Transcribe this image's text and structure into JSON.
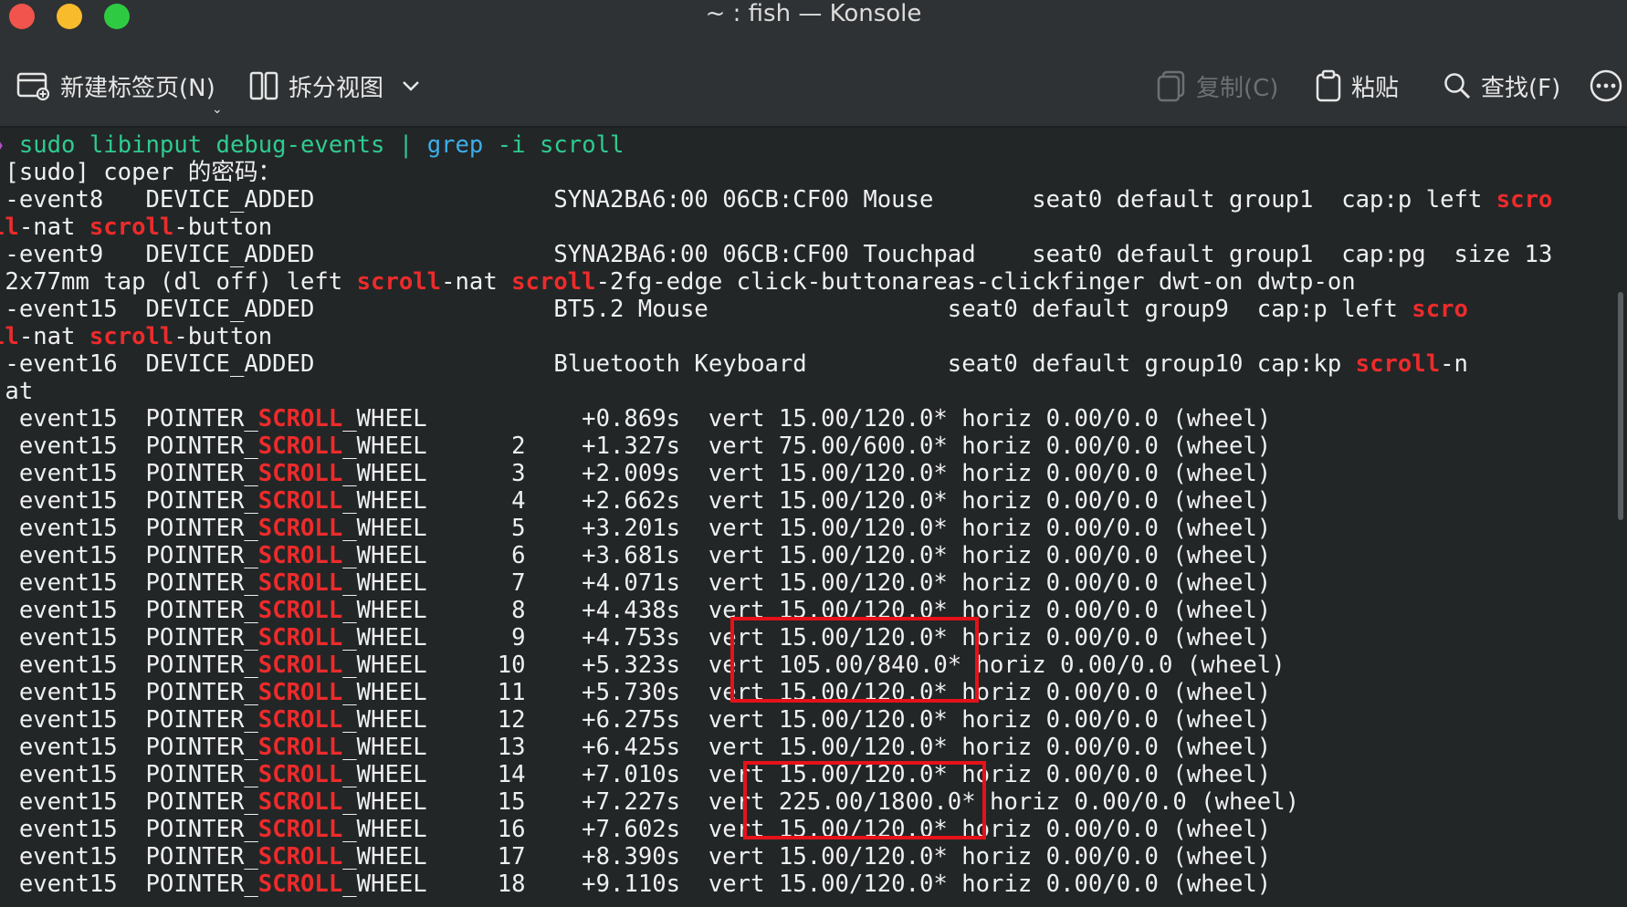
{
  "window": {
    "title": "~ : fish — Konsole"
  },
  "toolbar": {
    "new_tab_label": "新建标签页(N)",
    "split_view_label": "拆分视图",
    "copy_label": "复制(C)",
    "paste_label": "粘贴",
    "find_label": "查找(F)"
  },
  "icons": {
    "new_tab": "new-tab-icon",
    "split_view": "split-view-icon",
    "dropdown": "chevron-down-icon",
    "copy": "copy-icon",
    "paste": "clipboard-icon",
    "find": "search-icon",
    "more": "more-menu-icon"
  },
  "colors": {
    "background": "#232627",
    "titlebar": "#2f3234",
    "text": "#eff0f1",
    "command": "#2ecb8f",
    "grep": "#3daee9",
    "highlight": "#ed2b2b",
    "annotation_box": "#e5121a"
  },
  "terminal": {
    "lines": [
      [
        {
          "t": "❯ ",
          "c": "prompt-mark"
        },
        {
          "t": "sudo libinput debug-events ",
          "c": "cmd"
        },
        {
          "t": "| ",
          "c": "pipe"
        },
        {
          "t": "grep",
          "c": "grep"
        },
        {
          "t": " -i scroll",
          "c": "arg"
        }
      ],
      [
        {
          "t": " [sudo] coper 的密码："
        }
      ],
      [
        {
          "t": " -event8   DEVICE_ADDED                 SYNA2BA6:00 06CB:CF00 Mouse       seat0 default group1  cap:p left "
        },
        {
          "t": "scro",
          "c": "hl"
        }
      ],
      [
        {
          "t": "ll",
          "c": "hl"
        },
        {
          "t": "-nat "
        },
        {
          "t": "scroll",
          "c": "hl"
        },
        {
          "t": "-button"
        }
      ],
      [
        {
          "t": " -event9   DEVICE_ADDED                 SYNA2BA6:00 06CB:CF00 Touchpad    seat0 default group1  cap:pg  size 13"
        }
      ],
      [
        {
          "t": " 2x77mm tap (dl off) left "
        },
        {
          "t": "scroll",
          "c": "hl"
        },
        {
          "t": "-nat "
        },
        {
          "t": "scroll",
          "c": "hl"
        },
        {
          "t": "-2fg-edge click-buttonareas-clickfinger dwt-on dwtp-on"
        }
      ],
      [
        {
          "t": " -event15  DEVICE_ADDED                 BT5.2 Mouse                 seat0 default group9  cap:p left "
        },
        {
          "t": "scro",
          "c": "hl"
        }
      ],
      [
        {
          "t": "ll",
          "c": "hl"
        },
        {
          "t": "-nat "
        },
        {
          "t": "scroll",
          "c": "hl"
        },
        {
          "t": "-button"
        }
      ],
      [
        {
          "t": " -event16  DEVICE_ADDED                 Bluetooth Keyboard          seat0 default group10 cap:kp "
        },
        {
          "t": "scroll",
          "c": "hl"
        },
        {
          "t": "-n"
        }
      ],
      [
        {
          "t": " at"
        }
      ],
      [
        {
          "t": "  event15  POINTER_"
        },
        {
          "t": "SCROLL",
          "c": "hl"
        },
        {
          "t": "_WHEEL           +0.869s  vert 15.00/120.0* horiz 0.00/0.0 (wheel)"
        }
      ],
      [
        {
          "t": "  event15  POINTER_"
        },
        {
          "t": "SCROLL",
          "c": "hl"
        },
        {
          "t": "_WHEEL      2    +1.327s  vert 75.00/600.0* horiz 0.00/0.0 (wheel)"
        }
      ],
      [
        {
          "t": "  event15  POINTER_"
        },
        {
          "t": "SCROLL",
          "c": "hl"
        },
        {
          "t": "_WHEEL      3    +2.009s  vert 15.00/120.0* horiz 0.00/0.0 (wheel)"
        }
      ],
      [
        {
          "t": "  event15  POINTER_"
        },
        {
          "t": "SCROLL",
          "c": "hl"
        },
        {
          "t": "_WHEEL      4    +2.662s  vert 15.00/120.0* horiz 0.00/0.0 (wheel)"
        }
      ],
      [
        {
          "t": "  event15  POINTER_"
        },
        {
          "t": "SCROLL",
          "c": "hl"
        },
        {
          "t": "_WHEEL      5    +3.201s  vert 15.00/120.0* horiz 0.00/0.0 (wheel)"
        }
      ],
      [
        {
          "t": "  event15  POINTER_"
        },
        {
          "t": "SCROLL",
          "c": "hl"
        },
        {
          "t": "_WHEEL      6    +3.681s  vert 15.00/120.0* horiz 0.00/0.0 (wheel)"
        }
      ],
      [
        {
          "t": "  event15  POINTER_"
        },
        {
          "t": "SCROLL",
          "c": "hl"
        },
        {
          "t": "_WHEEL      7    +4.071s  vert 15.00/120.0* horiz 0.00/0.0 (wheel)"
        }
      ],
      [
        {
          "t": "  event15  POINTER_"
        },
        {
          "t": "SCROLL",
          "c": "hl"
        },
        {
          "t": "_WHEEL      8    +4.438s  vert 15.00/120.0* horiz 0.00/0.0 (wheel)"
        }
      ],
      [
        {
          "t": "  event15  POINTER_"
        },
        {
          "t": "SCROLL",
          "c": "hl"
        },
        {
          "t": "_WHEEL      9    +4.753s  vert 15.00/120.0* horiz 0.00/0.0 (wheel)"
        }
      ],
      [
        {
          "t": "  event15  POINTER_"
        },
        {
          "t": "SCROLL",
          "c": "hl"
        },
        {
          "t": "_WHEEL     10    +5.323s  vert 105.00/840.0* horiz 0.00/0.0 (wheel)"
        }
      ],
      [
        {
          "t": "  event15  POINTER_"
        },
        {
          "t": "SCROLL",
          "c": "hl"
        },
        {
          "t": "_WHEEL     11    +5.730s  vert 15.00/120.0* horiz 0.00/0.0 (wheel)"
        }
      ],
      [
        {
          "t": "  event15  POINTER_"
        },
        {
          "t": "SCROLL",
          "c": "hl"
        },
        {
          "t": "_WHEEL     12    +6.275s  vert 15.00/120.0* horiz 0.00/0.0 (wheel)"
        }
      ],
      [
        {
          "t": "  event15  POINTER_"
        },
        {
          "t": "SCROLL",
          "c": "hl"
        },
        {
          "t": "_WHEEL     13    +6.425s  vert 15.00/120.0* horiz 0.00/0.0 (wheel)"
        }
      ],
      [
        {
          "t": "  event15  POINTER_"
        },
        {
          "t": "SCROLL",
          "c": "hl"
        },
        {
          "t": "_WHEEL     14    +7.010s  vert 15.00/120.0* horiz 0.00/0.0 (wheel)"
        }
      ],
      [
        {
          "t": "  event15  POINTER_"
        },
        {
          "t": "SCROLL",
          "c": "hl"
        },
        {
          "t": "_WHEEL     15    +7.227s  vert 225.00/1800.0* horiz 0.00/0.0 (wheel)"
        }
      ],
      [
        {
          "t": "  event15  POINTER_"
        },
        {
          "t": "SCROLL",
          "c": "hl"
        },
        {
          "t": "_WHEEL     16    +7.602s  vert 15.00/120.0* horiz 0.00/0.0 (wheel)"
        }
      ],
      [
        {
          "t": "  event15  POINTER_"
        },
        {
          "t": "SCROLL",
          "c": "hl"
        },
        {
          "t": "_WHEEL     17    +8.390s  vert 15.00/120.0* horiz 0.00/0.0 (wheel)"
        }
      ],
      [
        {
          "t": "  event15  POINTER_"
        },
        {
          "t": "SCROLL",
          "c": "hl"
        },
        {
          "t": "_WHEEL     18    +9.110s  vert 15.00/120.0* horiz 0.00/0.0 (wheel)"
        }
      ]
    ]
  }
}
